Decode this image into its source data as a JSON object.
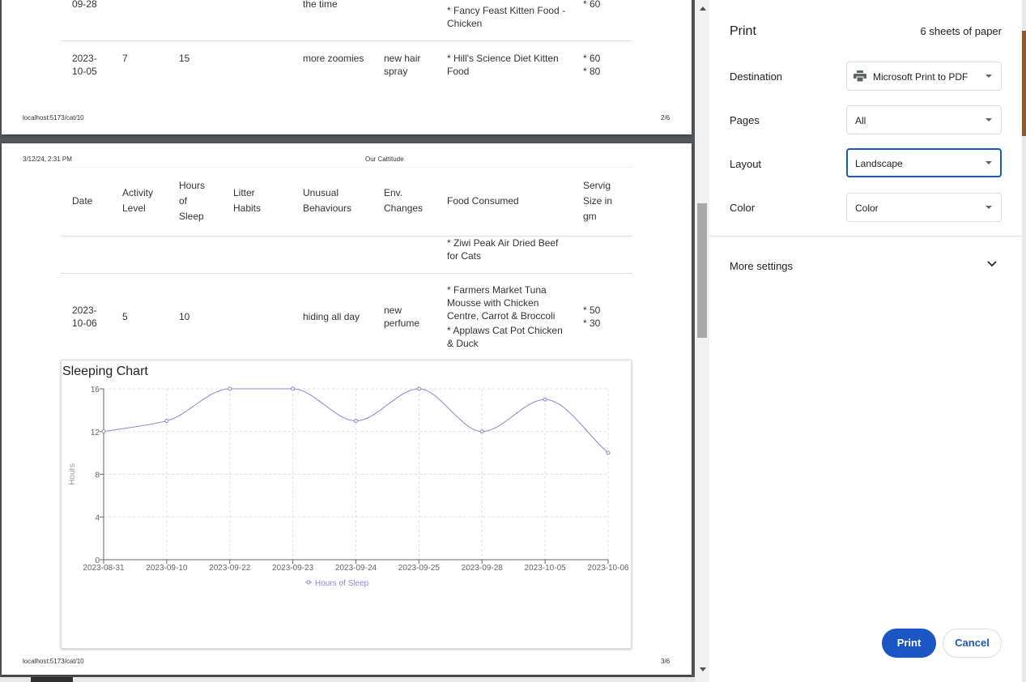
{
  "dialog": {
    "title": "Print",
    "sheets": "6 sheets of paper",
    "destination": {
      "label": "Destination",
      "value": "Microsoft Print to PDF"
    },
    "pages": {
      "label": "Pages",
      "value": "All"
    },
    "layout": {
      "label": "Layout",
      "value": "Landscape"
    },
    "color": {
      "label": "Color",
      "value": "Color"
    },
    "more_settings": "More settings",
    "print_button": "Print",
    "cancel_button": "Cancel"
  },
  "page1": {
    "prev_row": {
      "date": "09-28",
      "behaviours": "the time",
      "food": "* Fancy Feast Kitten Food - Chicken",
      "serving": "* 60"
    },
    "row": {
      "date": "2023-10-05",
      "activity": "7",
      "sleep": "15",
      "behaviours": "more zoomies",
      "env": "new hair spray",
      "food": "* Hill's Science Diet Kitten Food",
      "serving1": "* 60",
      "serving2": "* 80"
    },
    "footer_url": "localhost:5173/cat/10",
    "footer_page": "2/6"
  },
  "page2": {
    "header_datetime": "3/12/24, 2:31 PM",
    "header_title": "Our Cattitude",
    "columns": [
      "Date",
      "Activity Level",
      "Hours of Sleep",
      "Litter Habits",
      "Unusual Behaviours",
      "Env. Changes",
      "Food Consumed",
      "Servig Size in gm"
    ],
    "cont_food": "* Ziwi Peak Air Dried Beef for Cats",
    "row": {
      "date": "2023-10-06",
      "activity": "5",
      "sleep": "10",
      "behaviours": "hiding all day",
      "env": "new perfume",
      "food1": "* Farmers Market Tuna Mousse with Chicken Centre, Carrot & Broccoli",
      "food2": "* Applaws Cat Pot Chicken & Duck",
      "serving1": "* 50",
      "serving2": "* 30"
    },
    "footer_url": "localhost:5173/cat/10",
    "footer_page": "3/6"
  },
  "chart_data": {
    "type": "line",
    "title": "Sleeping Chart",
    "ylabel": "Hours",
    "xlabel": "",
    "categories": [
      "2023-08-31",
      "2023-09-10",
      "2023-09-22",
      "2023-09-23",
      "2023-09-24",
      "2023-09-25",
      "2023-09-28",
      "2023-10-05",
      "2023-10-06"
    ],
    "series": [
      {
        "name": "Hours of Sleep",
        "values": [
          12,
          13,
          16,
          16,
          13,
          16,
          12,
          15,
          10
        ],
        "color": "#8884d8"
      }
    ],
    "ylim": [
      0,
      16
    ],
    "yticks": [
      0,
      4,
      8,
      12,
      16
    ],
    "grid": true,
    "smooth": true,
    "legend": "bottom"
  }
}
